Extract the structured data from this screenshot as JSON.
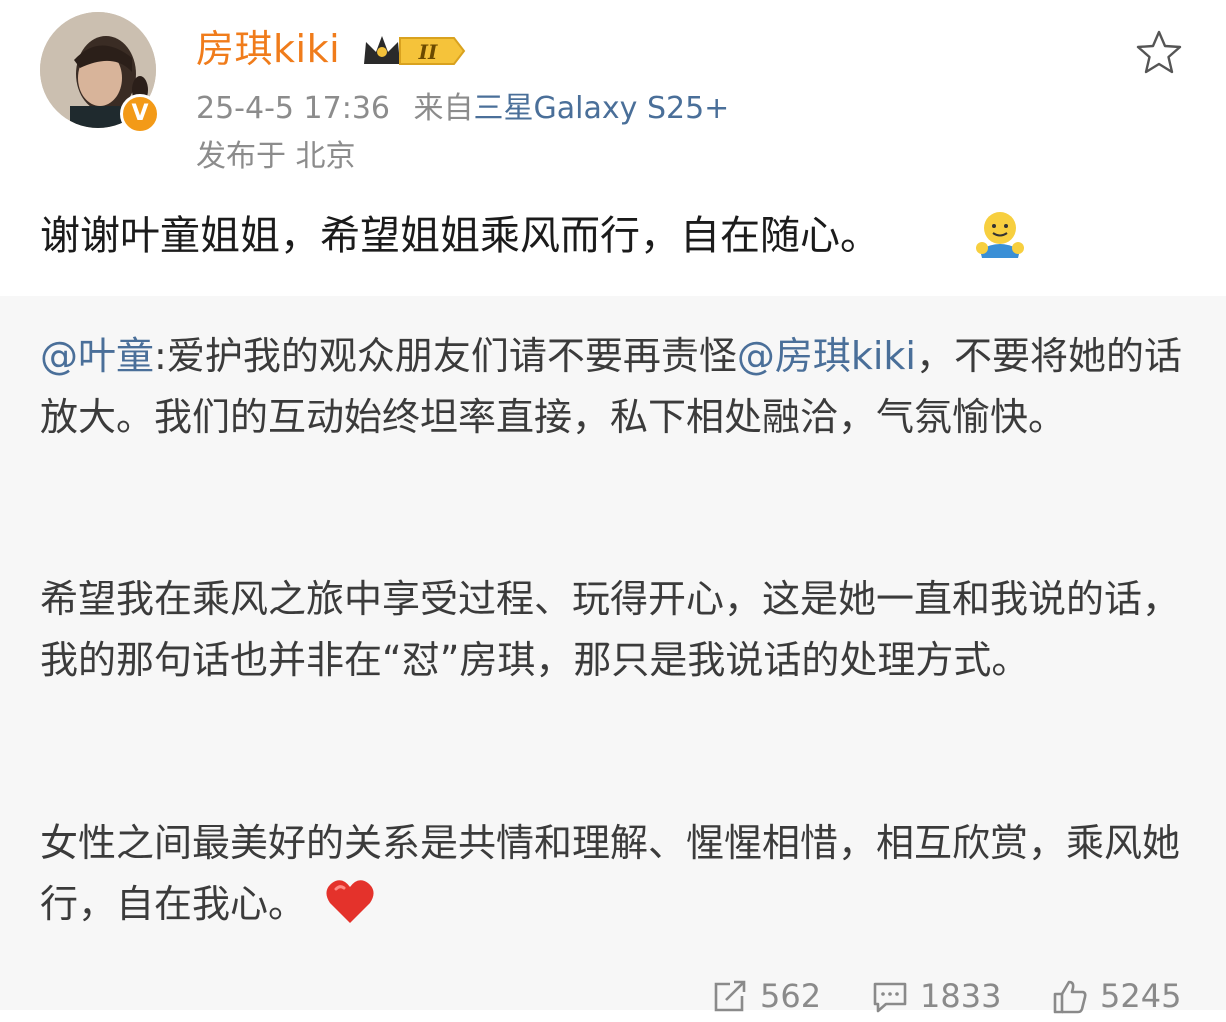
{
  "author": {
    "name": "房琪kiki",
    "verified_mark": "V",
    "level_mark": "II",
    "avatar_icon": "avatar-photo-icon"
  },
  "meta": {
    "datetime": "25-4-5 17:36",
    "source_prefix": "来自",
    "device": "三星Galaxy S25+",
    "location": "发布于 北京"
  },
  "post": {
    "text": "谢谢叶童姐姐，希望姐姐乘风而行，自在随心。",
    "emoji_icon": "hug-emoji-icon"
  },
  "quote": {
    "mention_author": "@叶童",
    "colon": ":",
    "para1_a": "爱护我的观众朋友们请不要再责怪",
    "mention_target": "@房琪kiki",
    "para1_b": "，不要将她的话放大。我们的互动始终坦率直接，私下相处融洽，气氛愉快。",
    "para2": "希望我在乘风之旅中享受过程、玩得开心，这是她一直和我说的话，我的那句话也并非在“怼”房琪，那只是我说话的处理方式。",
    "para3": "女性之间最美好的关系是共情和理解、惺惺相惜，相互欣赏，乘风她行，自在我心。",
    "heart_icon": "red-heart-icon"
  },
  "actions": {
    "repost_count": "562",
    "comment_count": "1833",
    "like_count": "5245"
  },
  "colors": {
    "username": "#f07c1b",
    "link": "#4a6f99",
    "meta": "#8c8c8c",
    "quote_bg": "#f7f7f7"
  }
}
